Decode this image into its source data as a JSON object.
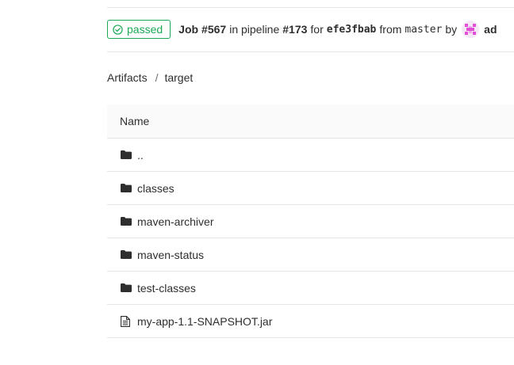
{
  "job_header": {
    "status": "passed",
    "job_label": "Job",
    "job_id": "#567",
    "in_pipeline_text": "in pipeline",
    "pipeline_id": "#173",
    "for_text": "for",
    "commit_sha": "efe3fbab",
    "from_text": "from",
    "branch": "master",
    "by_text": "by",
    "user": "ad"
  },
  "breadcrumb": {
    "root": "Artifacts",
    "separator": "/",
    "current": "target"
  },
  "table": {
    "header_name": "Name",
    "rows": [
      {
        "name": "..",
        "type": "folder",
        "icon": "folder-icon"
      },
      {
        "name": "classes",
        "type": "folder",
        "icon": "folder-icon"
      },
      {
        "name": "maven-archiver",
        "type": "folder",
        "icon": "folder-icon"
      },
      {
        "name": "maven-status",
        "type": "folder",
        "icon": "folder-icon"
      },
      {
        "name": "test-classes",
        "type": "folder",
        "icon": "folder-icon"
      },
      {
        "name": "my-app-1.1-SNAPSHOT.jar",
        "type": "file",
        "icon": "file-text-icon"
      }
    ]
  },
  "colors": {
    "success": "#1aaa55",
    "border": "#e5e5e5",
    "header_bg": "#fafafa",
    "text": "#2e2e2e"
  }
}
